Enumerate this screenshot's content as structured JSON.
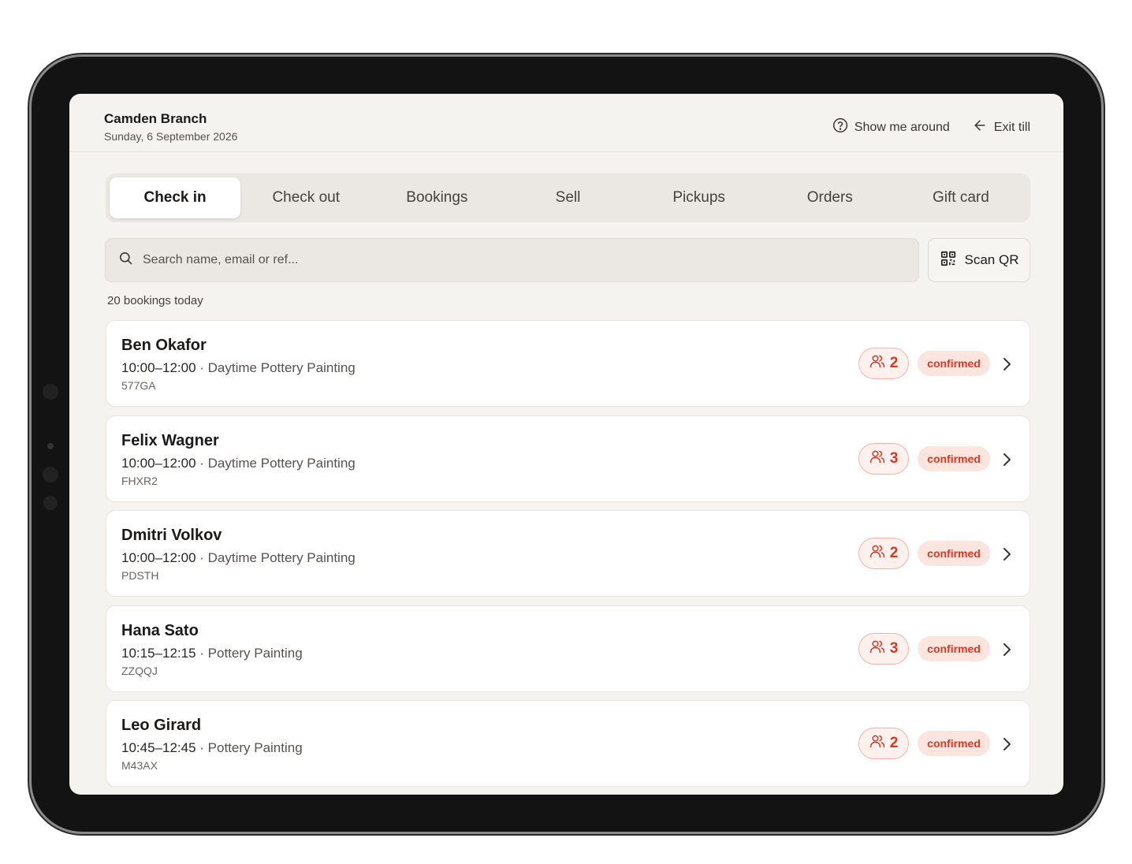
{
  "header": {
    "branch": "Camden Branch",
    "date": "Sunday, 6 September 2026",
    "show_me_around": "Show me around",
    "exit_till": "Exit till"
  },
  "tabs": [
    {
      "label": "Check in",
      "active": true
    },
    {
      "label": "Check out"
    },
    {
      "label": "Bookings"
    },
    {
      "label": "Sell"
    },
    {
      "label": "Pickups"
    },
    {
      "label": "Orders"
    },
    {
      "label": "Gift card"
    }
  ],
  "search": {
    "placeholder": "Search name, email or ref...",
    "scan_label": "Scan QR"
  },
  "bookings_count_text": "20 bookings today",
  "bookings": [
    {
      "name": "Ben Okafor",
      "time": "10:00–12:00",
      "event": "Daytime Pottery Painting",
      "ref": "577GA",
      "party": "2",
      "status": "confirmed"
    },
    {
      "name": "Felix Wagner",
      "time": "10:00–12:00",
      "event": "Daytime Pottery Painting",
      "ref": "FHXR2",
      "party": "3",
      "status": "confirmed"
    },
    {
      "name": "Dmitri Volkov",
      "time": "10:00–12:00",
      "event": "Daytime Pottery Painting",
      "ref": "PDSTH",
      "party": "2",
      "status": "confirmed"
    },
    {
      "name": "Hana Sato",
      "time": "10:15–12:15",
      "event": "Pottery Painting",
      "ref": "ZZQQJ",
      "party": "3",
      "status": "confirmed"
    },
    {
      "name": "Leo Girard",
      "time": "10:45–12:45",
      "event": "Pottery Painting",
      "ref": "M43AX",
      "party": "2",
      "status": "confirmed"
    }
  ],
  "meta_separator": " · ",
  "colors": {
    "accent": "#d63a24",
    "badge_bg": "#fce4df",
    "screen_bg": "#f5f3f0"
  },
  "icons": {
    "help": "question-circle-icon",
    "exit": "arrow-left-icon",
    "search": "search-icon",
    "scan": "qr-code-icon",
    "party": "users-icon",
    "row_action": "chevron-right-icon"
  }
}
